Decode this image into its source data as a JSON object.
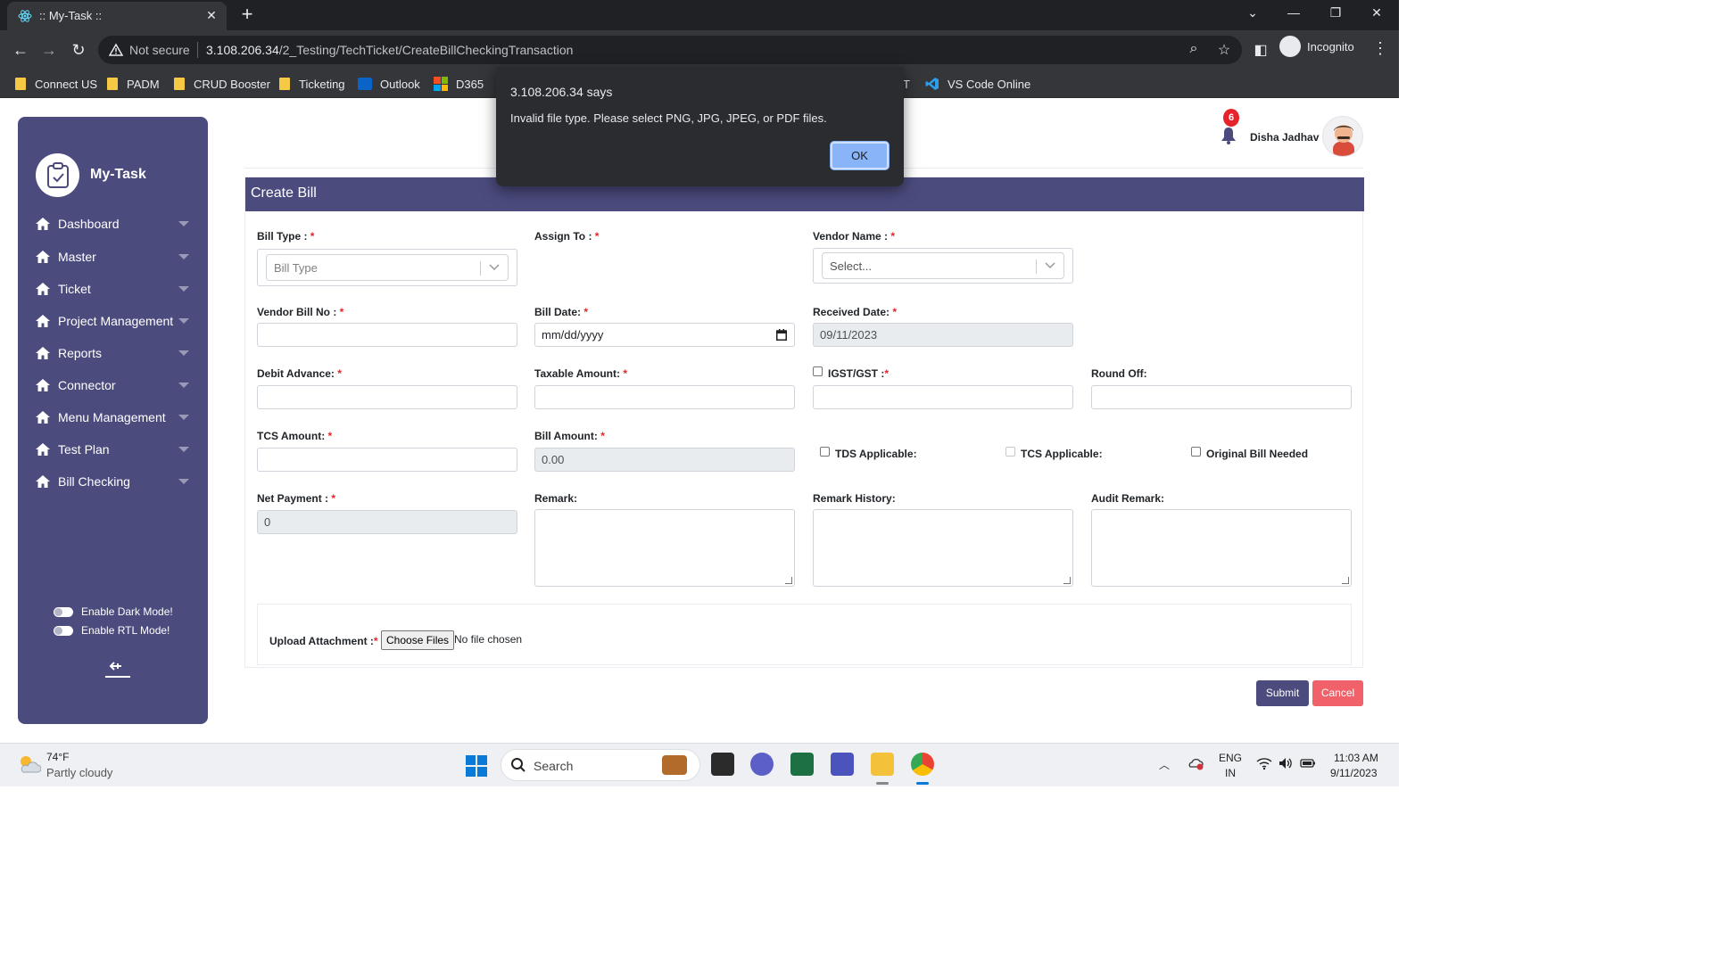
{
  "browser": {
    "tab_title": ":: My-Task ::",
    "security_label": "Not secure",
    "url_host": "3.108.206.34",
    "url_path": "/2_Testing/TechTicket/CreateBillCheckingTransaction",
    "profile_label": "Incognito",
    "bookmarks": [
      {
        "label": "Connect US",
        "icon": "folder-icon"
      },
      {
        "label": "PADM",
        "icon": "folder-icon"
      },
      {
        "label": "CRUD Booster",
        "icon": "folder-icon"
      },
      {
        "label": "Ticketing",
        "icon": "folder-icon"
      },
      {
        "label": "Outlook",
        "icon": "outlook-icon"
      },
      {
        "label": "D365",
        "icon": "microsoft-icon"
      },
      {
        "label": "T",
        "icon": ""
      },
      {
        "label": "VS Code Online",
        "icon": "vscode-icon"
      }
    ]
  },
  "alert": {
    "title": "3.108.206.34 says",
    "message": "Invalid file type. Please select PNG, JPG, JPEG, or PDF files.",
    "ok_label": "OK"
  },
  "sidebar": {
    "brand": "My-Task",
    "items": [
      {
        "label": "Dashboard"
      },
      {
        "label": "Master"
      },
      {
        "label": "Ticket"
      },
      {
        "label": "Project Management"
      },
      {
        "label": "Reports"
      },
      {
        "label": "Connector"
      },
      {
        "label": "Menu Management"
      },
      {
        "label": "Test Plan"
      },
      {
        "label": "Bill Checking"
      }
    ],
    "dark_mode_label": "Enable Dark Mode!",
    "rtl_mode_label": "Enable RTL Mode!"
  },
  "header": {
    "notification_count": "6",
    "user_name": "Disha Jadhav"
  },
  "form": {
    "title": "Create Bill",
    "required_mark": "*",
    "bill_type": {
      "label": "Bill Type : ",
      "placeholder": "Bill Type"
    },
    "assign_to": {
      "label": "Assign To : "
    },
    "vendor_name": {
      "label": "Vendor Name : ",
      "placeholder": "Select..."
    },
    "vendor_bill_no": {
      "label": "Vendor Bill No : ",
      "value": ""
    },
    "bill_date": {
      "label": "Bill Date: ",
      "value": "mm/dd/yyyy"
    },
    "received_date": {
      "label": "Received Date: ",
      "value": "09/11/2023"
    },
    "debit_advance": {
      "label": "Debit Advance: ",
      "value": ""
    },
    "taxable_amount": {
      "label": "Taxable Amount: ",
      "value": ""
    },
    "igst_gst": {
      "label": "IGST/GST :",
      "checked": false
    },
    "round_off": {
      "label": "Round Off:",
      "value": ""
    },
    "tcs_amount": {
      "label": "TCS Amount: ",
      "value": ""
    },
    "bill_amount": {
      "label": "Bill Amount: ",
      "value": "0.00"
    },
    "tds_applicable": {
      "label": "TDS Applicable:",
      "checked": false
    },
    "tcs_applicable": {
      "label": "TCS Applicable:",
      "checked": false
    },
    "original_bill_needed": {
      "label": "Original Bill Needed",
      "checked": false
    },
    "net_payment": {
      "label": "Net Payment : ",
      "value": "0"
    },
    "remark": {
      "label": "Remark:"
    },
    "remark_history": {
      "label": "Remark History:"
    },
    "audit_remark": {
      "label": "Audit Remark:"
    },
    "upload": {
      "label": "Upload Attachment :",
      "button": "Choose Files",
      "status": "No file chosen"
    },
    "submit_label": "Submit",
    "cancel_label": "Cancel"
  },
  "taskbar": {
    "temperature": "74°F",
    "weather": "Partly cloudy",
    "search_label": "Search",
    "lang_line1": "ENG",
    "lang_line2": "IN",
    "time": "11:03 AM",
    "date": "9/11/2023"
  },
  "colors": {
    "primary": "#4b4b7e",
    "danger": "#f0616a",
    "required": "#e6232a"
  }
}
